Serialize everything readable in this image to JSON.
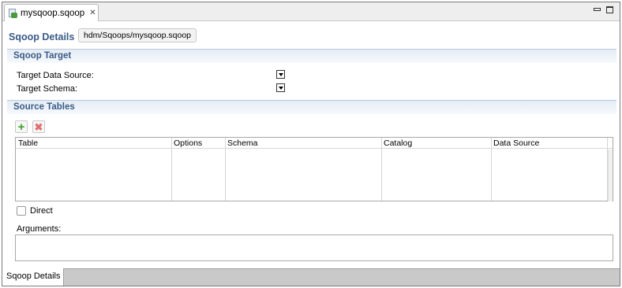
{
  "editor_tab": {
    "label": "mysqoop.sqoop",
    "icon": "sqoop-file-icon",
    "close_icon": "close-icon"
  },
  "window_controls": {
    "minimize_icon": "minimize-icon",
    "maximize_icon": "maximize-icon"
  },
  "header": {
    "title": "Sqoop Details",
    "path": "hdm/Sqoops/mysqoop.sqoop"
  },
  "target_section": {
    "title": "Sqoop Target",
    "data_source_label": "Target Data Source:",
    "schema_label": "Target Schema:"
  },
  "source_section": {
    "title": "Source Tables",
    "add_icon": "add-icon",
    "remove_icon": "remove-icon",
    "columns": [
      "Table",
      "Options",
      "Schema",
      "Catalog",
      "Data Source"
    ],
    "rows": []
  },
  "direct_checkbox": {
    "label": "Direct",
    "checked": false
  },
  "arguments": {
    "label": "Arguments:",
    "value": ""
  },
  "bottom_tabs": [
    {
      "label": "Sqoop Details",
      "active": true
    }
  ],
  "colors": {
    "section_title": "#3a5b85",
    "add_green": "#3ea02c",
    "remove_red": "#e07070"
  }
}
